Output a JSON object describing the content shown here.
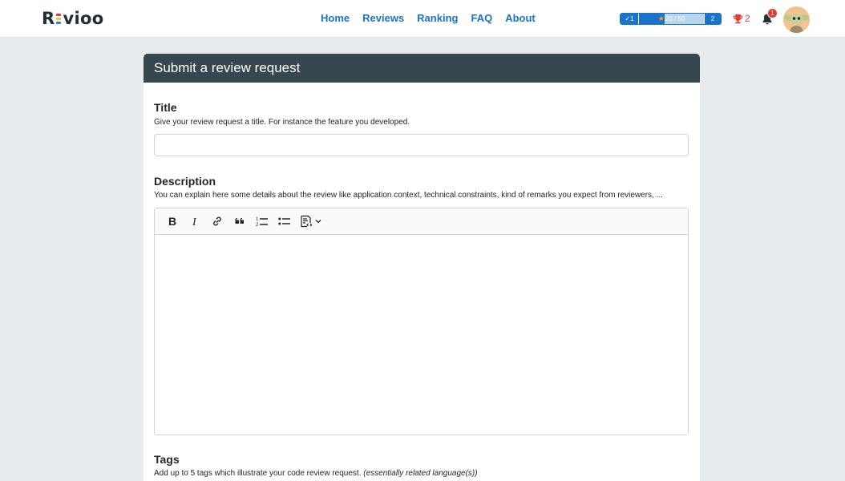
{
  "brand": {
    "logo_text_left": "R",
    "logo_text_right": "vioo",
    "dot_colors": [
      "#e53935",
      "#fbc02d",
      "#1e88e5"
    ]
  },
  "nav": {
    "links": [
      {
        "label": "Home"
      },
      {
        "label": "Reviews"
      },
      {
        "label": "Ranking"
      },
      {
        "label": "FAQ"
      },
      {
        "label": "About"
      }
    ]
  },
  "progress": {
    "level": "1",
    "current_xp": "20 / 50",
    "fraction": 0.4,
    "next_level": "2",
    "check_glyph": "✓"
  },
  "trophies": {
    "count": "2",
    "color": "#e53935"
  },
  "notifications": {
    "count": "1"
  },
  "form": {
    "header_title": "Submit a review request",
    "title_label": "Title",
    "title_help": "Give your review request a title. For instance the feature you developed.",
    "title_value": "",
    "description_label": "Description",
    "description_help": "You can explain here some details about the review like application context, technical constraints, kind of remarks you expect from reviewers, ...",
    "toolbar_icons": [
      "bold-icon",
      "italic-icon",
      "link-icon",
      "quote-icon",
      "numbered-list-icon",
      "bulleted-list-icon",
      "code-block-icon",
      "chevron-down-icon"
    ],
    "tags_label": "Tags",
    "tags_help": "Add up to 5 tags which illustrate your code review request.",
    "tags_help_note": "(essentially related language(s))"
  },
  "colors": {
    "accent": "#1a73c9",
    "header_bg": "#37474f",
    "page_bg": "#e9ecef"
  }
}
